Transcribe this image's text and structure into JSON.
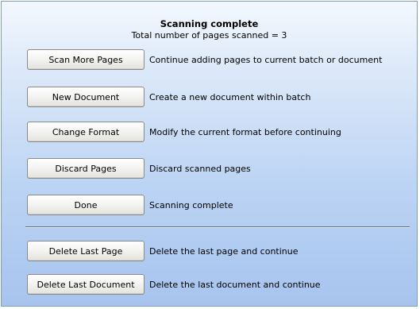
{
  "header": {
    "title": "Scanning complete",
    "subtitle": "Total number of pages scanned = 3"
  },
  "actions": [
    {
      "label": "Scan More Pages",
      "description": "Continue adding pages to current batch or document"
    },
    {
      "label": "New Document",
      "description": "Create a new document within batch"
    },
    {
      "label": "Change Format",
      "description": "Modify the current format before continuing"
    },
    {
      "label": "Discard Pages",
      "description": "Discard scanned pages"
    },
    {
      "label": "Done",
      "description": "Scanning complete"
    }
  ],
  "delete_actions": [
    {
      "label": "Delete Last Page",
      "description": "Delete the last page and continue"
    },
    {
      "label": "Delete Last Document",
      "description": "Delete the last document and continue"
    }
  ]
}
